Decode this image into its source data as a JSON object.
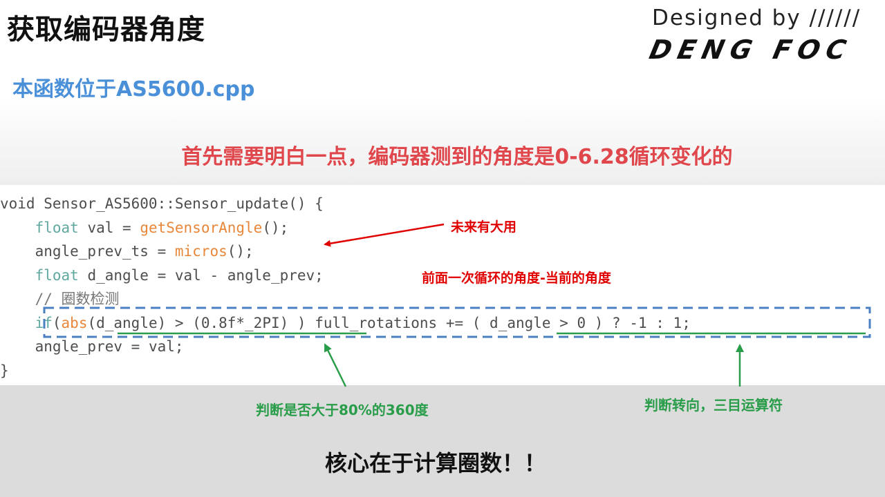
{
  "slide": {
    "title": "获取编码器角度",
    "subtitle": "本函数位于AS5600.cpp",
    "brand": {
      "line1": "Designed by  //////",
      "line2": "DENG FOC"
    },
    "headline": "首先需要明白一点，编码器测到的角度是0-6.28循环变化的",
    "code": {
      "l1": "void Sensor_AS5600::Sensor_update() {",
      "l2_kw": "float",
      "l2_mid": " val = ",
      "l2_fn": "getSensorAngle",
      "l2_end": "();",
      "l3_a": "angle_prev_ts = ",
      "l3_fn": "micros",
      "l3_end": "();",
      "l4_kw": "float",
      "l4_rest": " d_angle = val - angle_prev;",
      "l5": "// 圈数检测",
      "l6_kw": "if",
      "l6_p": "(",
      "l6_fn": "abs",
      "l6_rest": "(d_angle) > (0.8f*_2PI) ) full_rotations += ( d_angle > 0 ) ? -1 : 1;",
      "l7": "angle_prev = val;",
      "l8": "}"
    },
    "annotations": {
      "future_use": "未来有大用",
      "prev_minus_curr": "前面一次循环的角度-当前的角度",
      "over_80_percent": "判断是否大于80%的360度",
      "direction_ternary": "判断转向，三目运算符"
    },
    "bottom_text": "核心在于计算圈数！！",
    "colors": {
      "title": "#111111",
      "subtitle": "#4a90d9",
      "headline": "#e0474c",
      "red_annotation": "#e00000",
      "green_annotation": "#2a9d4a",
      "dashed_box": "#4a7fc1",
      "bottom_band": "#dcdcdc"
    }
  }
}
